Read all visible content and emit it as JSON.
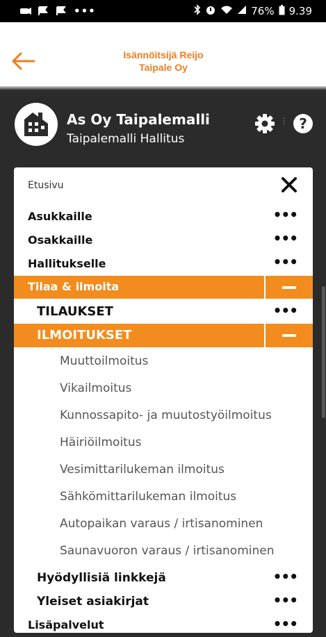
{
  "statusbar": {
    "battery": "76%",
    "time": "9.39"
  },
  "header": {
    "title_line1": "Isännöitsijä Reijo",
    "title_line2": "Taipale Oy"
  },
  "profile": {
    "name": "As Oy Taipalemalli",
    "subtitle": "Taipalemalli Hallitus",
    "help_symbol": "?"
  },
  "menu": {
    "home": "Etusivu",
    "items": [
      "Asukkaille",
      "Osakkaille",
      "Hallitukselle"
    ],
    "active_section": "Tilaa & ilmoita",
    "sub_orders": "TILAUKSET",
    "sub_notices": "ILMOITUKSET",
    "notices": [
      "Muuttoilmoitus",
      "Vikailmoitus",
      "Kunnossapito- ja muutostyöilmoitus",
      "Häiriöilmoitus",
      "Vesimittarilukeman ilmoitus",
      "Sähkömittarilukeman ilmoitus",
      "Autopaikan varaus / irtisanominen",
      "Saunavuoron varaus / irtisanominen"
    ],
    "useful_links": "Hyödyllisiä linkkejä",
    "general_docs": "Yleiset asiakirjat",
    "extra_services": "Lisäpalvelut"
  },
  "colors": {
    "accent": "#f28c1e",
    "header_title": "#f07c1e",
    "background": "#2b2b2b"
  }
}
